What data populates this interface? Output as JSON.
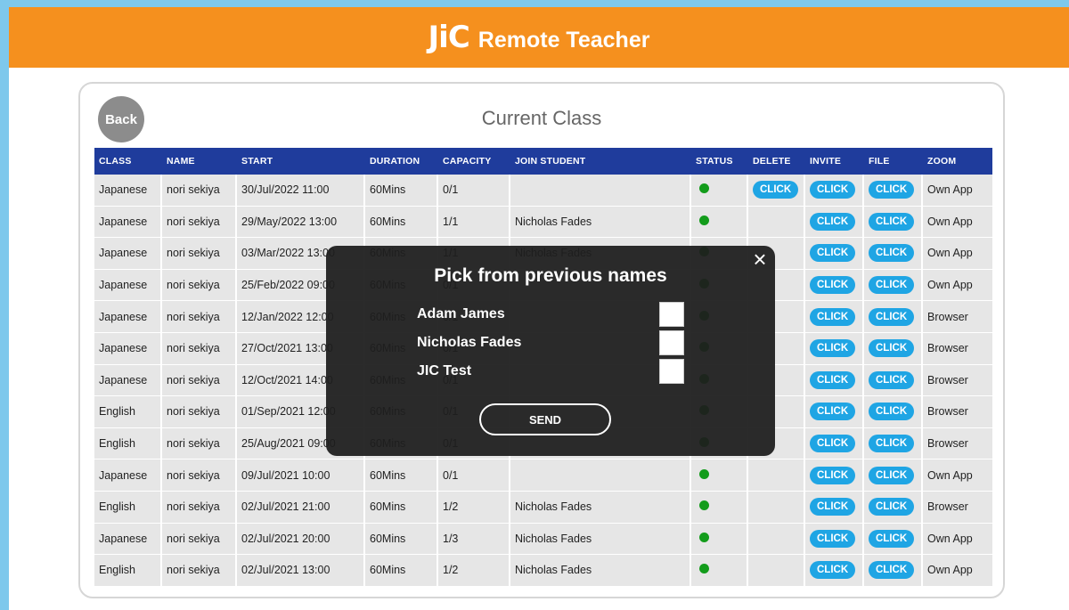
{
  "header": {
    "logo_mark": "JiC",
    "title": "Remote Teacher"
  },
  "card": {
    "back_label": "Back",
    "title": "Current Class"
  },
  "table": {
    "columns": [
      "CLASS",
      "NAME",
      "START",
      "DURATION",
      "CAPACITY",
      "JOIN STUDENT",
      "STATUS",
      "DELETE",
      "INVITE",
      "FILE",
      "ZOOM"
    ],
    "click_label": "CLICK",
    "status_color": "#139c1b",
    "rows": [
      {
        "class": "Japanese",
        "name": "nori sekiya",
        "start": "30/Jul/2022 11:00",
        "duration": "60Mins",
        "capacity": "0/1",
        "join": "",
        "status": "online",
        "delete": true,
        "zoom": "Own App"
      },
      {
        "class": "Japanese",
        "name": "nori sekiya",
        "start": "29/May/2022 13:00",
        "duration": "60Mins",
        "capacity": "1/1",
        "join": "Nicholas Fades",
        "status": "online",
        "delete": false,
        "zoom": "Own App"
      },
      {
        "class": "Japanese",
        "name": "nori sekiya",
        "start": "03/Mar/2022 13:00",
        "duration": "60Mins",
        "capacity": "1/1",
        "join": "Nicholas Fades",
        "status": "online",
        "delete": false,
        "zoom": "Own App"
      },
      {
        "class": "Japanese",
        "name": "nori sekiya",
        "start": "25/Feb/2022 09:00",
        "duration": "60Mins",
        "capacity": "0/1",
        "join": "",
        "status": "online",
        "delete": false,
        "zoom": "Own App"
      },
      {
        "class": "Japanese",
        "name": "nori sekiya",
        "start": "12/Jan/2022 12:00",
        "duration": "60Mins",
        "capacity": "0/1",
        "join": "",
        "status": "online",
        "delete": false,
        "zoom": "Browser"
      },
      {
        "class": "Japanese",
        "name": "nori sekiya",
        "start": "27/Oct/2021 13:00",
        "duration": "60Mins",
        "capacity": "0/1",
        "join": "",
        "status": "online",
        "delete": false,
        "zoom": "Browser"
      },
      {
        "class": "Japanese",
        "name": "nori sekiya",
        "start": "12/Oct/2021 14:00",
        "duration": "60Mins",
        "capacity": "0/1",
        "join": "",
        "status": "online",
        "delete": false,
        "zoom": "Browser"
      },
      {
        "class": "English",
        "name": "nori sekiya",
        "start": "01/Sep/2021 12:00",
        "duration": "60Mins",
        "capacity": "0/1",
        "join": "",
        "status": "online",
        "delete": false,
        "zoom": "Browser"
      },
      {
        "class": "English",
        "name": "nori sekiya",
        "start": "25/Aug/2021 09:00",
        "duration": "60Mins",
        "capacity": "0/1",
        "join": "",
        "status": "online",
        "delete": false,
        "zoom": "Browser"
      },
      {
        "class": "Japanese",
        "name": "nori sekiya",
        "start": "09/Jul/2021 10:00",
        "duration": "60Mins",
        "capacity": "0/1",
        "join": "",
        "status": "online",
        "delete": false,
        "zoom": "Own App"
      },
      {
        "class": "English",
        "name": "nori sekiya",
        "start": "02/Jul/2021 21:00",
        "duration": "60Mins",
        "capacity": "1/2",
        "join": "Nicholas Fades",
        "status": "online",
        "delete": false,
        "zoom": "Browser"
      },
      {
        "class": "Japanese",
        "name": "nori sekiya",
        "start": "02/Jul/2021 20:00",
        "duration": "60Mins",
        "capacity": "1/3",
        "join": "Nicholas Fades",
        "status": "online",
        "delete": false,
        "zoom": "Own App"
      },
      {
        "class": "English",
        "name": "nori sekiya",
        "start": "02/Jul/2021 13:00",
        "duration": "60Mins",
        "capacity": "1/2",
        "join": "Nicholas Fades",
        "status": "online",
        "delete": false,
        "zoom": "Own App"
      }
    ]
  },
  "modal": {
    "close_glyph": "×",
    "title": "Pick from previous names",
    "names": [
      "Adam James",
      "Nicholas Fades",
      "JIC Test"
    ],
    "send_label": "SEND"
  }
}
